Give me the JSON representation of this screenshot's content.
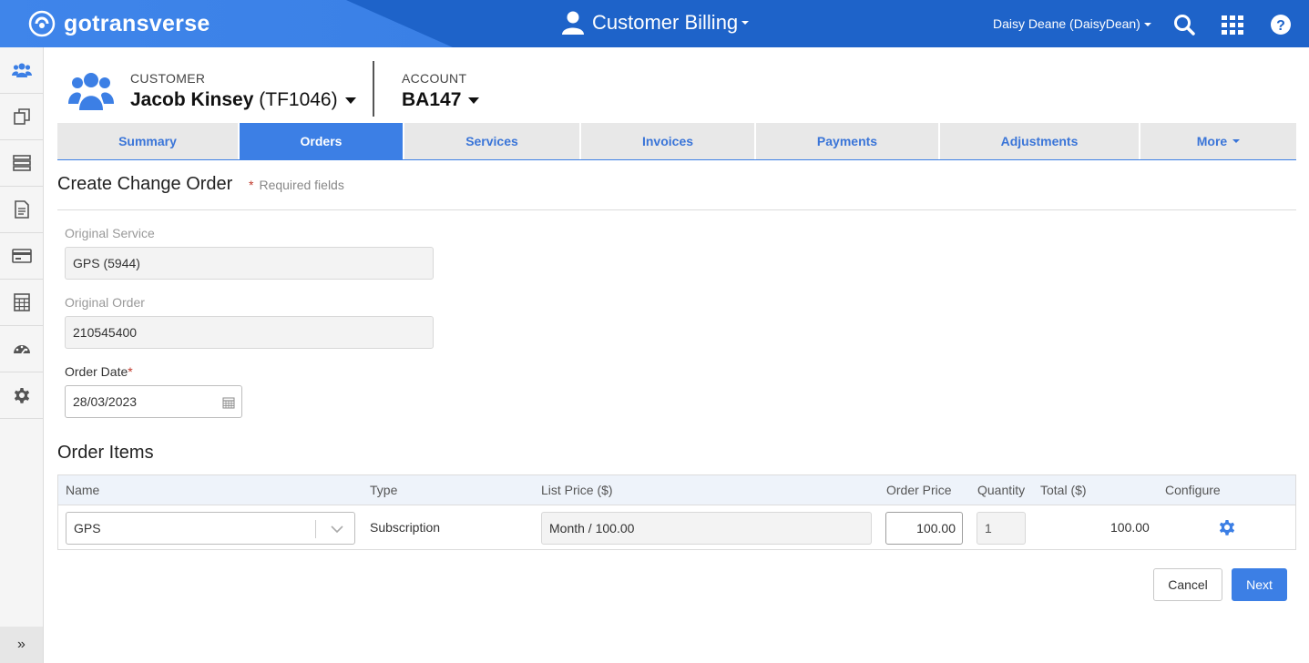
{
  "topbar": {
    "logo_text": "gotransverse",
    "app_title": "Customer Billing",
    "user": "Daisy Deane (DaisyDean)",
    "icons": [
      "search-icon",
      "apps-grid-icon",
      "help-icon"
    ],
    "colors": {
      "bar": "#1e63c9",
      "brand": "#3f85ea"
    }
  },
  "sidebar": {
    "items": [
      "customers-icon",
      "copy-icon",
      "server-icon",
      "document-icon",
      "credit-card-icon",
      "calculator-icon",
      "dashboard-icon",
      "gear-icon"
    ],
    "expand_label": "»"
  },
  "customer": {
    "label": "CUSTOMER",
    "name": "Jacob Kinsey",
    "id": "(TF1046)"
  },
  "account": {
    "label": "ACCOUNT",
    "id": "BA147"
  },
  "tabs": [
    {
      "label": "Summary",
      "active": false
    },
    {
      "label": "Orders",
      "active": true
    },
    {
      "label": "Services",
      "active": false
    },
    {
      "label": "Invoices",
      "active": false
    },
    {
      "label": "Payments",
      "active": false
    },
    {
      "label": "Adjustments",
      "active": false
    },
    {
      "label": "More",
      "active": false
    }
  ],
  "form": {
    "title": "Create Change Order",
    "required_note": "Required fields",
    "original_service": {
      "label": "Original Service",
      "value": "GPS (5944)"
    },
    "original_order": {
      "label": "Original Order",
      "value": "210545400"
    },
    "order_date": {
      "label": "Order Date",
      "value": "28/03/2023"
    }
  },
  "order_items": {
    "title": "Order Items",
    "headers": {
      "name": "Name",
      "type": "Type",
      "list_price": "List Price ($)",
      "order_price": "Order Price",
      "quantity": "Quantity",
      "total": "Total ($)",
      "configure": "Configure"
    },
    "rows": [
      {
        "name": "GPS",
        "type": "Subscription",
        "list_price": "Month / 100.00",
        "order_price": "100.00",
        "quantity": "1",
        "total": "100.00"
      }
    ]
  },
  "actions": {
    "cancel": "Cancel",
    "next": "Next"
  },
  "accent_color": "#3c7fe5"
}
